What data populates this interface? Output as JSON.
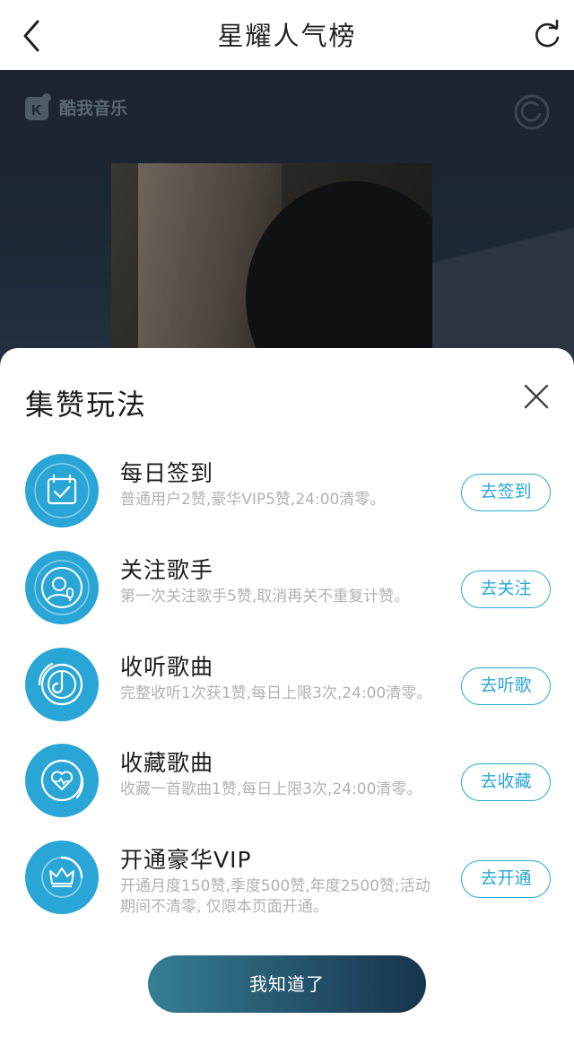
{
  "header": {
    "title": "星耀人气榜"
  },
  "hero": {
    "logo_text": "酷我音乐"
  },
  "modal": {
    "title": "集赞玩法",
    "tasks": [
      {
        "icon": "calendar-check-icon",
        "title": "每日签到",
        "desc": "普通用户2赞,豪华VIP5赞,24:00清零。",
        "button": "去签到"
      },
      {
        "icon": "follow-singer-icon",
        "title": "关注歌手",
        "desc": "第一次关注歌手5赞,取消再关不重复计赞。",
        "button": "去关注"
      },
      {
        "icon": "music-disc-icon",
        "title": "收听歌曲",
        "desc": "完整收听1次获1赞,每日上限3次,24:00清零。",
        "button": "去听歌"
      },
      {
        "icon": "heart-disc-icon",
        "title": "收藏歌曲",
        "desc": "收藏一首歌曲1赞,每日上限3次,24:00清零。",
        "button": "去收藏"
      },
      {
        "icon": "crown-icon",
        "title": "开通豪华VIP",
        "desc": "开通月度150赞,季度500赞,年度2500赞;活动期间不清零, 仅限本页面开通。",
        "button": "去开通"
      }
    ],
    "confirm": "我知道了"
  },
  "colors": {
    "accent": "#2aa6d6",
    "confirm_start": "#357f95",
    "confirm_end": "#17354c"
  }
}
